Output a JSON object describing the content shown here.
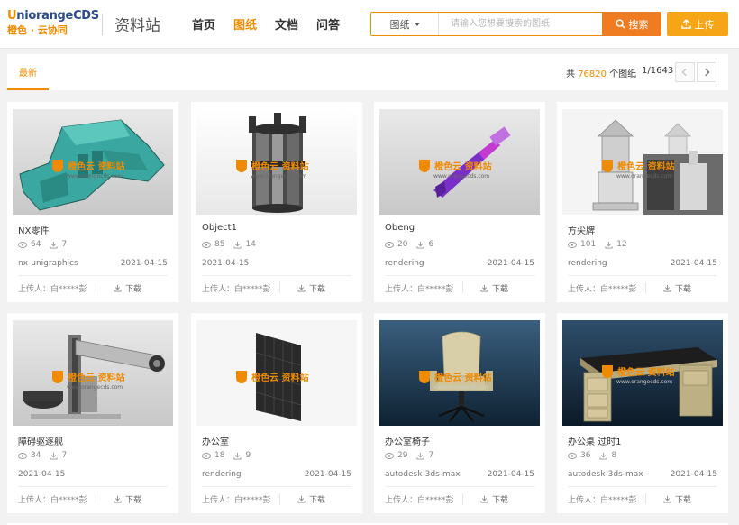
{
  "brand": {
    "logo_u": "U",
    "logo_rest": "niorangeCDS",
    "logo_cn": "橙色 · 云协同",
    "site_name": "资料站"
  },
  "nav": [
    {
      "label": "首页",
      "active": false
    },
    {
      "label": "图纸",
      "active": true
    },
    {
      "label": "文档",
      "active": false
    },
    {
      "label": "问答",
      "active": false
    }
  ],
  "search": {
    "category": "图纸",
    "placeholder": "请输入您想要搜索的图纸",
    "button_label": "搜索"
  },
  "upload_label": "上传",
  "filter": {
    "tab": "最新",
    "total_prefix": "共",
    "total_count": "76820",
    "total_suffix": "个图纸",
    "page_info": "1/1643"
  },
  "colors": {
    "accent": "#f08a00",
    "search_button": "#f07c22",
    "upload_button": "#f5a516"
  },
  "watermark": {
    "text": "橙色云 资料站",
    "url": "www.orangecds.com"
  },
  "uploader_label": "上传人：",
  "download_label": "下载",
  "cards": [
    {
      "title": "NX零件",
      "views": "64",
      "downloads": "7",
      "category": "nx-unigraphics",
      "date": "2021-04-15",
      "uploader": "白*****彭",
      "thumb": "teal-part"
    },
    {
      "title": "Object1",
      "views": "85",
      "downloads": "14",
      "category": "",
      "date": "2021-04-15",
      "uploader": "白*****彭",
      "thumb": "cylinder"
    },
    {
      "title": "Obeng",
      "views": "20",
      "downloads": "6",
      "category": "rendering",
      "date": "2021-04-15",
      "uploader": "白*****彭",
      "thumb": "screwdriver"
    },
    {
      "title": "方尖牌",
      "views": "101",
      "downloads": "12",
      "category": "rendering",
      "date": "2021-04-15",
      "uploader": "白*****彭",
      "thumb": "obelisk"
    },
    {
      "title": "障碍驱逐舰",
      "views": "34",
      "downloads": "7",
      "category": "",
      "date": "2021-04-15",
      "uploader": "白*****彭",
      "thumb": "machine"
    },
    {
      "title": "办公室",
      "views": "18",
      "downloads": "9",
      "category": "rendering",
      "date": "2021-04-15",
      "uploader": "白*****彭",
      "thumb": "panel"
    },
    {
      "title": "办公室椅子",
      "views": "29",
      "downloads": "7",
      "category": "autodesk-3ds-max",
      "date": "2021-04-15",
      "uploader": "白*****彭",
      "thumb": "chair"
    },
    {
      "title": "办公桌 过时1",
      "views": "36",
      "downloads": "8",
      "category": "autodesk-3ds-max",
      "date": "2021-04-15",
      "uploader": "白*****彭",
      "thumb": "desk"
    }
  ]
}
